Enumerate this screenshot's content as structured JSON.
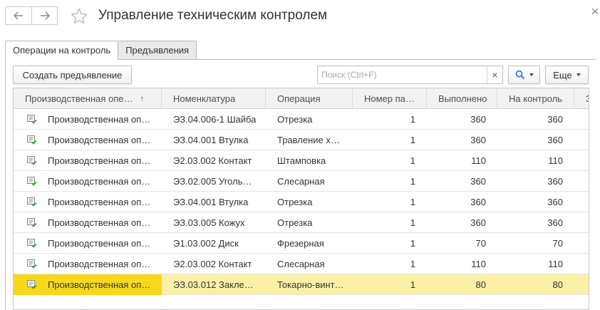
{
  "window": {
    "title": "Управление техническим контролем",
    "back_icon": "arrow-left-icon",
    "forward_icon": "arrow-right-icon",
    "favorite_icon": "star-icon",
    "close_icon": "close-icon"
  },
  "tabs": [
    {
      "label": "Операции на контроль",
      "active": true
    },
    {
      "label": "Предъявления",
      "active": false
    }
  ],
  "toolbar": {
    "create_label": "Создать предъявление",
    "search_placeholder": "Поиск (Ctrl+F)",
    "clear_label": "×",
    "more_label": "Еще"
  },
  "table": {
    "headers": [
      "Производственная опе…",
      "Номенклатура",
      "Операция",
      "Номер па…",
      "Выполнено",
      "На контроль",
      "З"
    ],
    "sort_indicator": "↑",
    "rows": [
      [
        "Производственная оп…",
        "ЭЗ.04.006-1 Шайба",
        "Отрезка",
        "1",
        "360",
        "360"
      ],
      [
        "Производственная оп…",
        "ЭЗ.04.001 Втулка",
        "Травление х…",
        "1",
        "360",
        "360"
      ],
      [
        "Производственная оп…",
        "Э2.03.002 Контакт",
        "Штамповка",
        "1",
        "110",
        "110"
      ],
      [
        "Производственная оп…",
        "ЭЗ.02.005 Уголь…",
        "Слесарная",
        "1",
        "360",
        "360"
      ],
      [
        "Производственная оп…",
        "ЭЗ.04.001 Втулка",
        "Отрезка",
        "1",
        "360",
        "360"
      ],
      [
        "Производственная оп…",
        "ЭЗ.03.005 Кожух",
        "Отрезка",
        "1",
        "360",
        "360"
      ],
      [
        "Производственная оп…",
        "Э1.03.002 Диск",
        "Фрезерная",
        "1",
        "70",
        "70"
      ],
      [
        "Производственная оп…",
        "Э2.03.002 Контакт",
        "Слесарная",
        "1",
        "110",
        "110"
      ],
      [
        "Производственная оп…",
        "ЭЗ.03.012 Закле…",
        "Токарно-винт…",
        "1",
        "80",
        "80"
      ]
    ],
    "selected_row": 8,
    "row_icon": "document-check-icon"
  },
  "colors": {
    "selected_row": "#fbf0a6",
    "selected_cell": "#f8d81c",
    "icon_green": "#3aa53a",
    "accent_blue": "#3a7bd5"
  }
}
